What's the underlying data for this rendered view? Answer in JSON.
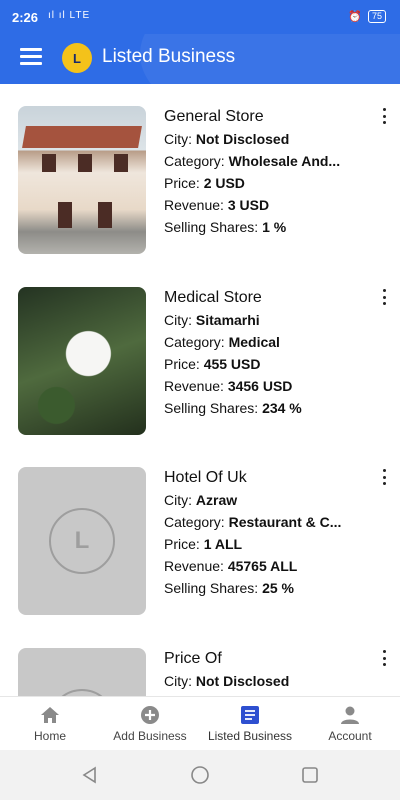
{
  "status_bar": {
    "time": "2:26",
    "signal": "ıl ıl LTE",
    "battery": "75"
  },
  "app_bar": {
    "title": "Listed Business",
    "logo_text": "L"
  },
  "listings": [
    {
      "name": "General Store",
      "city_label": "City: ",
      "city": "Not Disclosed",
      "category_label": "Category: ",
      "category": "Wholesale And...",
      "price_label": "Price: ",
      "price": "2 USD",
      "revenue_label": "Revenue: ",
      "revenue": "3 USD",
      "shares_label": "Selling Shares: ",
      "shares": "1 %",
      "image": "house-photo"
    },
    {
      "name": "Medical Store",
      "city_label": "City: ",
      "city": "Sitamarhi",
      "category_label": "Category: ",
      "category": "Medical",
      "price_label": "Price: ",
      "price": "455 USD",
      "revenue_label": "Revenue: ",
      "revenue": "3456 USD",
      "shares_label": "Selling Shares: ",
      "shares": "234 %",
      "image": "flower-photo"
    },
    {
      "name": "Hotel Of Uk",
      "city_label": "City: ",
      "city": "Azraw",
      "category_label": "Category: ",
      "category": "Restaurant & C...",
      "price_label": "Price: ",
      "price": "1 ALL",
      "revenue_label": "Revenue: ",
      "revenue": "45765 ALL",
      "shares_label": "Selling Shares: ",
      "shares": "25 %",
      "image": "logo-placeholder"
    },
    {
      "name": "Price Of",
      "city_label": "City: ",
      "city": "Not Disclosed",
      "image": "logo-placeholder"
    }
  ],
  "bottom_nav": [
    {
      "label": "Home",
      "icon": "home-icon"
    },
    {
      "label": "Add Business",
      "icon": "add-circle-icon"
    },
    {
      "label": "Listed Business",
      "icon": "list-icon"
    },
    {
      "label": "Account",
      "icon": "person-icon"
    }
  ],
  "colors": {
    "primary": "#2e6ce6",
    "logo": "#f4c21a",
    "active_nav": "#2e4fd0"
  }
}
